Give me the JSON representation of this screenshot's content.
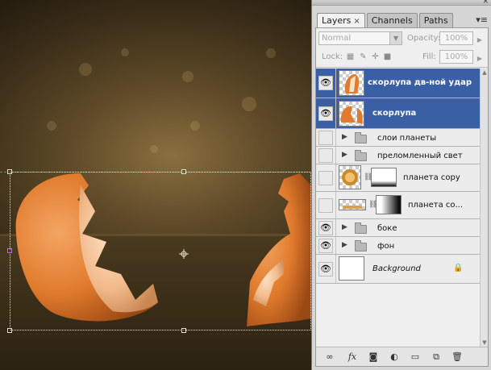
{
  "panel": {
    "tabs": [
      {
        "label": "Layers",
        "active": true,
        "close": "×"
      },
      {
        "label": "Channels",
        "active": false
      },
      {
        "label": "Paths",
        "active": false
      }
    ],
    "close_glyph": "×",
    "menu_glyph": "▾≡",
    "blend_mode": "Normal",
    "opacity_label": "Opacity:",
    "opacity_value": "100%",
    "lock_label": "Lock:",
    "fill_label": "Fill:",
    "fill_value": "100%"
  },
  "layers": [
    {
      "name": "скорлупа дв-ной удар",
      "selected": true,
      "visible": true,
      "type": "pixel"
    },
    {
      "name": "скорлупа",
      "selected": true,
      "visible": true,
      "type": "pixel"
    },
    {
      "name": "слои планеты",
      "selected": false,
      "visible": false,
      "type": "group"
    },
    {
      "name": "преломленный свет",
      "selected": false,
      "visible": false,
      "type": "group"
    },
    {
      "name": "планета copy",
      "selected": false,
      "visible": false,
      "type": "masked"
    },
    {
      "name": "планета со...",
      "selected": false,
      "visible": false,
      "type": "masked"
    },
    {
      "name": "боке",
      "selected": false,
      "visible": true,
      "type": "group"
    },
    {
      "name": "фон",
      "selected": false,
      "visible": true,
      "type": "group"
    },
    {
      "name": "Background",
      "selected": false,
      "visible": true,
      "type": "background",
      "locked": true
    }
  ],
  "bottom_icons": [
    "link-icon",
    "fx-icon",
    "mask-icon",
    "adjustment-icon",
    "group-icon",
    "new-layer-icon",
    "trash-icon"
  ],
  "colors": {
    "selection": "#3b5fa5",
    "panel_bg": "#d6d6d6",
    "eggshell": "#e07a2c"
  }
}
